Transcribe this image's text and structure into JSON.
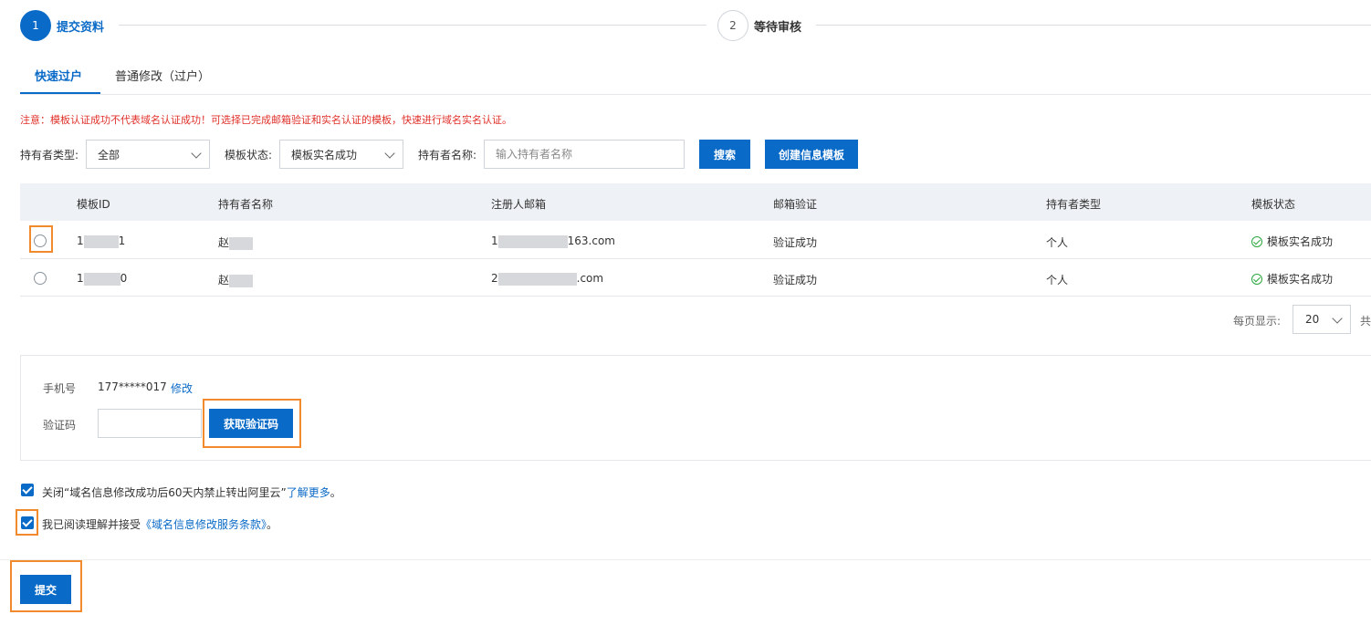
{
  "steps": [
    {
      "number": "1",
      "label": "提交资料"
    },
    {
      "number": "2",
      "label": "等待审核"
    }
  ],
  "tabs": {
    "quick": "快速过户",
    "normal": "普通修改（过户）"
  },
  "notice": "注意：模板认证成功不代表域名认证成功！可选择已完成邮箱验证和实名认证的模板，快速进行域名实名认证。",
  "filters": {
    "holder_type_label": "持有者类型:",
    "holder_type_value": "全部",
    "template_status_label": "模板状态:",
    "template_status_value": "模板实名成功",
    "holder_name_label": "持有者名称:",
    "holder_name_placeholder": "输入持有者名称",
    "search_button": "搜索",
    "create_button": "创建信息模板"
  },
  "table": {
    "headers": [
      "模板ID",
      "持有者名称",
      "注册人邮箱",
      "邮箱验证",
      "持有者类型",
      "模板状态"
    ],
    "rows": [
      {
        "id_prefix": "1",
        "id_suffix": "1",
        "holder_prefix": "赵",
        "email_prefix": "1",
        "email_suffix": "163.com",
        "email_verify": "验证成功",
        "holder_type": "个人",
        "status": "模板实名成功"
      },
      {
        "id_prefix": "1",
        "id_suffix": "0",
        "holder_prefix": "赵",
        "email_prefix": "2",
        "email_suffix": ".com",
        "email_verify": "验证成功",
        "holder_type": "个人",
        "status": "模板实名成功"
      }
    ]
  },
  "pagination": {
    "per_page_label": "每页显示:",
    "per_page_value": "20",
    "total_prefix": "共"
  },
  "verification": {
    "phone_label": "手机号",
    "phone_value": "177*****017",
    "modify_link": "修改",
    "code_label": "验证码",
    "get_code_button": "获取验证码"
  },
  "agreements": {
    "close_restriction_text": "关闭“域名信息修改成功后60天内禁止转出阿里云”",
    "learn_more": "了解更多",
    "period": "。",
    "accept_text": "我已阅读理解并接受",
    "terms_link": "《域名信息修改服务条款》",
    "period2": "。"
  },
  "submit_button": "提交",
  "colors": {
    "primary": "#0a6ac7",
    "highlight": "#f08a2c",
    "success": "#2aa63f",
    "warning": "#e0302a"
  }
}
